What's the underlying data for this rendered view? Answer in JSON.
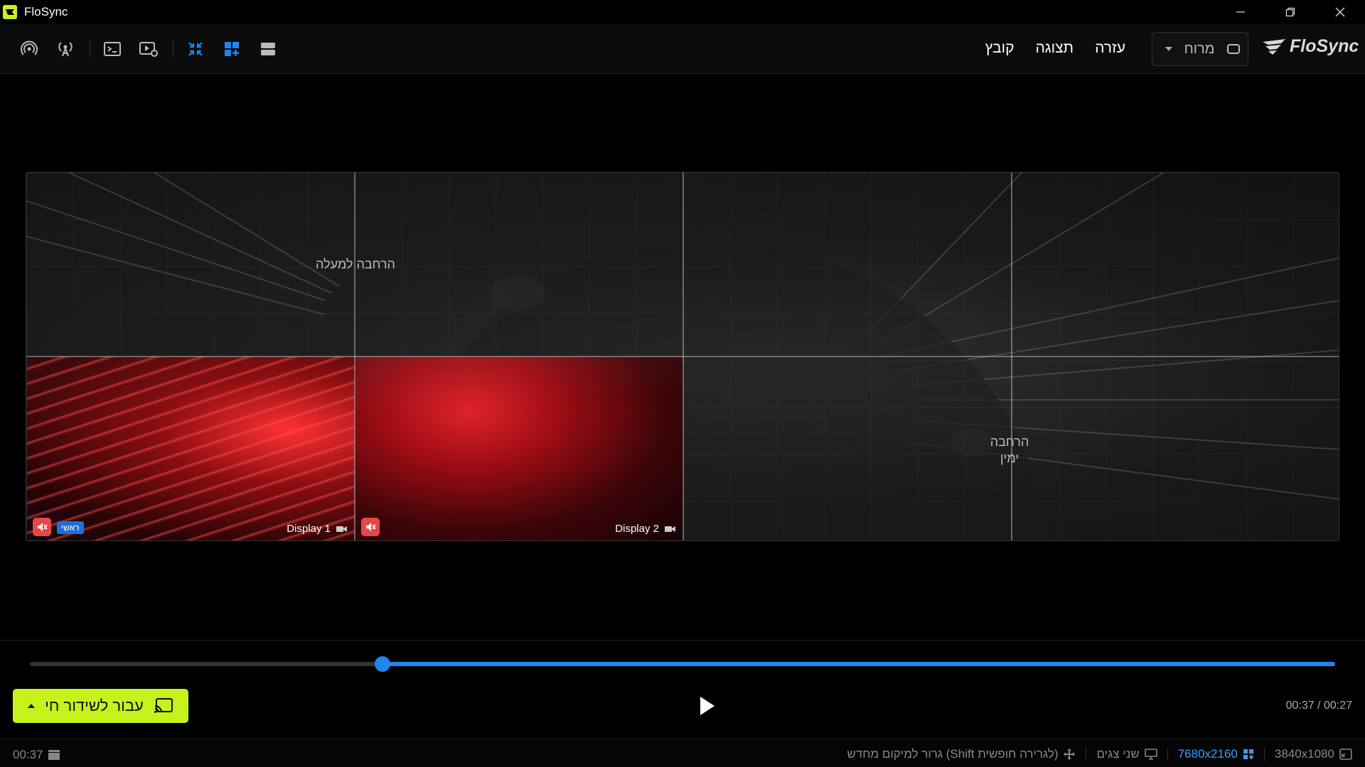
{
  "window": {
    "title": "FloSync"
  },
  "toolbar": {
    "icons": [
      "broadcast-icon",
      "antenna-icon",
      "terminal-icon",
      "video-settings-icon",
      "compress-icon",
      "grid-add-icon",
      "rows-icon"
    ],
    "menu": {
      "file": "קובץ",
      "view": "תצוגה",
      "help": "עזרה"
    },
    "mode_select": {
      "value": "מרוח"
    },
    "brand": "FloSync"
  },
  "canvas": {
    "expand_up_label": "הרחבה למעלה",
    "expand_right_label": "הרחבה\nימין",
    "displays": [
      {
        "label": "Display 1",
        "primary_badge": "ראשי",
        "muted": true
      },
      {
        "label": "Display 2",
        "primary_badge": "",
        "muted": true
      }
    ]
  },
  "playback": {
    "progress": 0.27,
    "live_button": "עבור לשידור חי",
    "time": "00:37 / 00:27"
  },
  "statusbar": {
    "duration": "00:37",
    "hint": "גרור למיקום מחדש (Shift לגרירה חופשית)",
    "screens": "שני צגים",
    "canvas_resolution": "7680x2160",
    "display_resolution": "3840x1080"
  },
  "colors": {
    "accent_green": "#c6f11b",
    "accent_blue": "#1e88f0",
    "mute_red": "#e64747"
  }
}
